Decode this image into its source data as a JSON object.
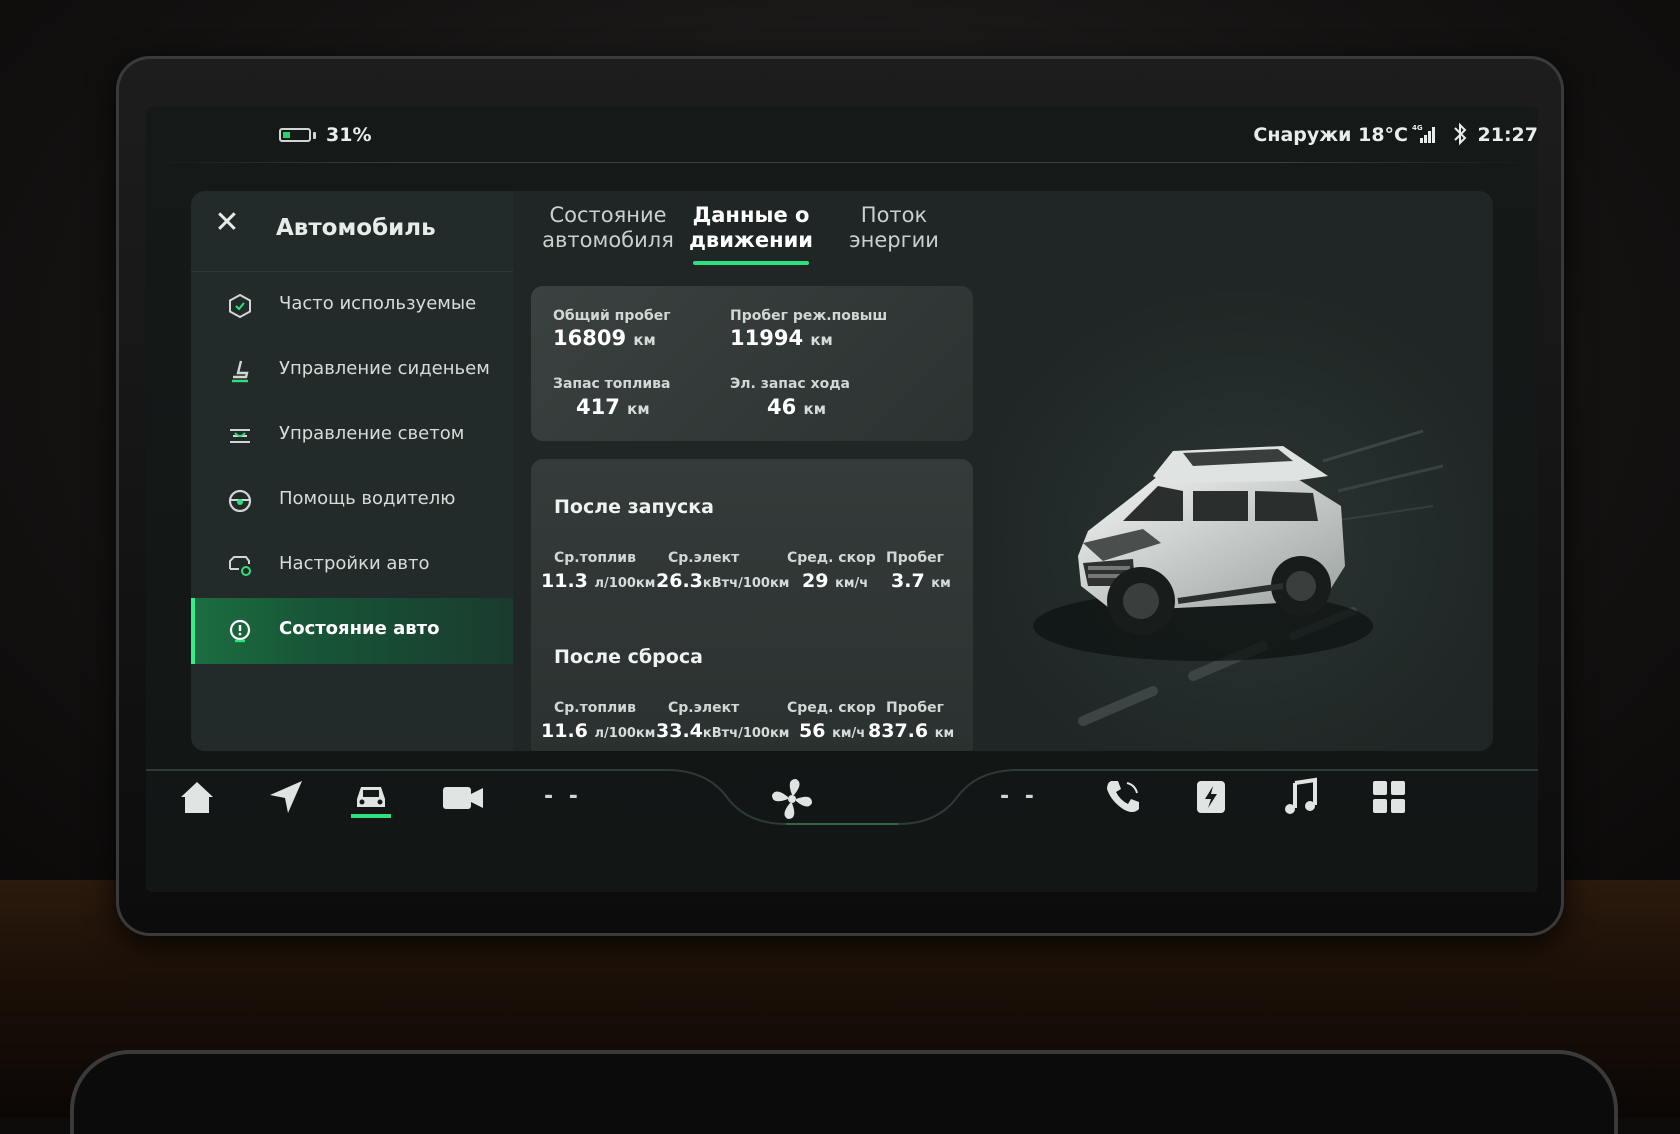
{
  "status": {
    "battery": "31%",
    "battery_level": 0.31,
    "outside_temp": "Снаружи 18°С",
    "network": "4G",
    "time": "21:27"
  },
  "sidebar": {
    "title": "Автомобиль",
    "items": [
      {
        "label": "Часто используемые",
        "icon": "hexagon-check-icon",
        "active": false
      },
      {
        "label": "Управление сиденьем",
        "icon": "seat-icon",
        "active": false
      },
      {
        "label": "Управление светом",
        "icon": "headlight-icon",
        "active": false
      },
      {
        "label": "Помощь водителю",
        "icon": "steering-wheel-icon",
        "active": false
      },
      {
        "label": "Настройки авто",
        "icon": "car-settings-icon",
        "active": false
      },
      {
        "label": "Состояние авто",
        "icon": "vehicle-status-icon",
        "active": true
      }
    ]
  },
  "tabs": [
    {
      "line1": "Состояние",
      "line2": "автомобиля",
      "active": false
    },
    {
      "line1": "Данные о",
      "line2": "движении",
      "active": true
    },
    {
      "line1": "Поток",
      "line2": "энергии",
      "active": false
    }
  ],
  "summary": {
    "total_mileage": {
      "label": "Общий пробег",
      "value": "16809",
      "unit": "км"
    },
    "range_extender_mileage": {
      "label": "Пробег реж.повыш",
      "value": "11994",
      "unit": "км"
    },
    "fuel_range": {
      "label": "Запас топлива",
      "value": "417",
      "unit": "км"
    },
    "electric_range": {
      "label": "Эл. запас хода",
      "value": "46",
      "unit": "км"
    }
  },
  "trips": [
    {
      "title": "После запуска",
      "cells": [
        {
          "label": "Ср.топлив",
          "value": "11.3",
          "unit": "л/100км"
        },
        {
          "label": "Ср.элект",
          "value": "26.3",
          "unit": "кВтч/100км"
        },
        {
          "label": "Сред. скор",
          "value": "29",
          "unit": "км/ч"
        },
        {
          "label": "Пробег",
          "value": "3.7",
          "unit": "км"
        }
      ]
    },
    {
      "title": "После сброса",
      "cells": [
        {
          "label": "Ср.топлив",
          "value": "11.6",
          "unit": "л/100км"
        },
        {
          "label": "Ср.элект",
          "value": "33.4",
          "unit": "кВтч/100км"
        },
        {
          "label": "Сред. скор",
          "value": "56",
          "unit": "км/ч"
        },
        {
          "label": "Пробег",
          "value": "837.6",
          "unit": "км"
        }
      ]
    }
  ],
  "dock": {
    "items": [
      "home-icon",
      "navigation-icon",
      "vehicle-icon",
      "camera-icon",
      "climate-fan-icon",
      "phone-icon",
      "charging-icon",
      "music-icon",
      "apps-grid-icon"
    ],
    "left_temp": "- -",
    "right_temp": "- -"
  },
  "colors": {
    "accent": "#2fe07d",
    "active_bg": "#175436",
    "panel": "#1f2625",
    "card": "#343b3a"
  }
}
